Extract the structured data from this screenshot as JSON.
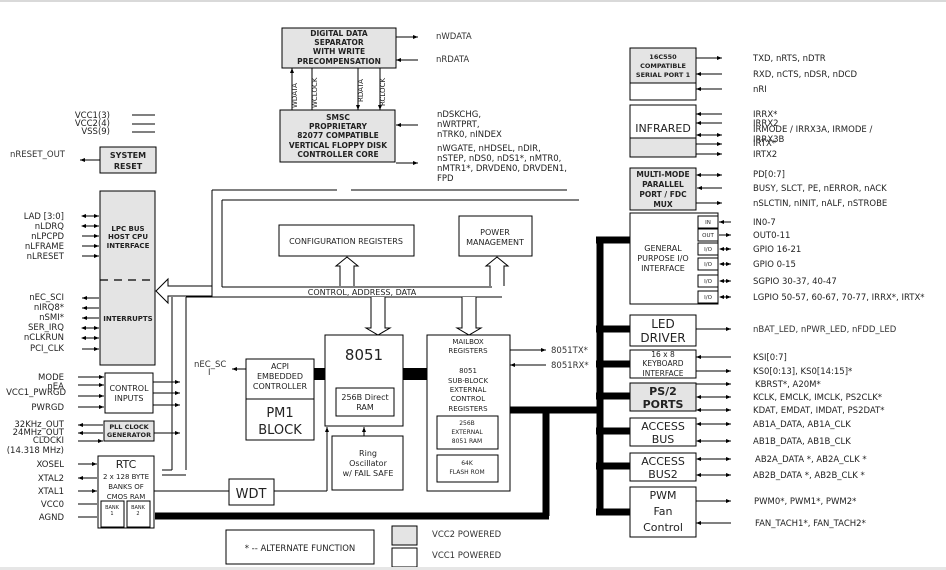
{
  "blocks": {
    "dds": [
      "DIGITAL DATA",
      "SEPARATOR",
      "WITH WRITE",
      "PRECOMPENSATION"
    ],
    "fdc": [
      "SMSC",
      "PROPRIETARY",
      "82077 COMPATIBLE",
      "VERTICAL FLOPPY DISK",
      "CONTROLLER CORE"
    ],
    "dds_fdc_signals": [
      "WDATA",
      "WCLOCK",
      "RDATA",
      "RCLOCK"
    ],
    "system_reset": [
      "SYSTEM",
      "RESET"
    ],
    "lpc": [
      "LPC BUS",
      "HOST CPU",
      "INTERFACE"
    ],
    "interrupts": "INTERRUPTS",
    "config_registers": "CONFIGURATION REGISTERS",
    "power_mgmt": [
      "POWER",
      "MANAGEMENT"
    ],
    "bus_label": "CONTROL, ADDRESS, DATA",
    "control_inputs": [
      "CONTROL",
      "INPUTS"
    ],
    "pll": [
      "PLL CLOCK",
      "GENERATOR"
    ],
    "rtc": [
      "RTC",
      "2 x 128 BYTE",
      "BANKS OF",
      "CMOS RAM"
    ],
    "bank1": [
      "BANK",
      "1"
    ],
    "bank2": [
      "BANK",
      "2"
    ],
    "acpi": [
      "ACPI",
      "EMBEDDED",
      "CONTROLLER"
    ],
    "pm1": [
      "PM1",
      "BLOCK"
    ],
    "cpu8051": "8051",
    "direct_ram": [
      "256B Direct",
      "RAM"
    ],
    "ring_osc": [
      "Ring",
      "Oscillator",
      "w/ FAIL SAFE"
    ],
    "wdt": "WDT",
    "mailbox": [
      "MAILBOX",
      "REGISTERS"
    ],
    "subblock": [
      "8051",
      "SUB-BLOCK",
      "EXTERNAL",
      "CONTROL",
      "REGISTERS"
    ],
    "ext_ram": [
      "256B",
      "EXTERNAL",
      "8051 RAM"
    ],
    "flash": [
      "64K",
      "FLASH ROM"
    ],
    "serial": [
      "16C550",
      "COMPATIBLE",
      "SERIAL PORT 1"
    ],
    "infrared": "INFRARED",
    "parallel": [
      "MULTI-MODE",
      "PARALLEL",
      "PORT / FDC",
      "MUX"
    ],
    "gpio": [
      "GENERAL",
      "PURPOSE I/O",
      "INTERFACE"
    ],
    "gpio_ports": [
      "IN",
      "OUT",
      "I/O",
      "I/O",
      "I/O",
      "I/O"
    ],
    "led": [
      "LED",
      "DRIVER"
    ],
    "keyboard": [
      "16 x 8",
      "KEYBOARD",
      "INTERFACE"
    ],
    "ps2": [
      "PS/2",
      "PORTS"
    ],
    "access_bus": [
      "ACCESS",
      "BUS"
    ],
    "access_bus2": [
      "ACCESS",
      "BUS2"
    ],
    "pwm": [
      "PWM",
      "Fan",
      "Control"
    ]
  },
  "signals": {
    "dds_right": [
      "nWDATA",
      "nRDATA"
    ],
    "fdc_right": [
      "nDSKCHG,",
      "nWRTPRT,",
      "nTRK0, nINDEX",
      "nWGATE, nHDSEL, nDIR,",
      "nSTEP, nDS0, nDS1*, nMTR0,",
      "nMTR1*, DRVDEN0, DRVDEN1,",
      "FPD"
    ],
    "power_pins": [
      "VCC1(3)",
      "VCC2(4)",
      "VSS(9)"
    ],
    "reset_out": "nRESET_OUT",
    "lpc_pins": [
      "LAD [3:0]",
      "nLDRQ",
      "nLPCPD",
      "nLFRAME",
      "nLRESET"
    ],
    "irq_pins": [
      "nEC_SCI",
      "nIRQ8*",
      "nSMI*",
      "SER_IRQ",
      "nCLKRUN",
      "PCI_CLK"
    ],
    "control_pins": [
      "MODE",
      "nEA",
      "VCC1_PWRGD",
      "PWRGD"
    ],
    "clock_pins": [
      "32KHz_OUT",
      "24MHz_OUT",
      "CLOCKI",
      "(14.318 MHz)"
    ],
    "rtc_pins": [
      "XOSEL",
      "XTAL2",
      "XTAL1",
      "VCC0",
      "AGND"
    ],
    "acpi_sci": [
      "nEC_SC",
      "I"
    ],
    "mailbox_pins": [
      "8051TX*",
      "8051RX*"
    ],
    "serial_pins": [
      "TXD, nRTS, nDTR",
      "RXD, nCTS, nDSR, nDCD",
      "nRI"
    ],
    "ir_pins": [
      "IRRX*",
      "IRRX2",
      "IRMODE / IRRX3A, IRMODE /",
      "IRRX3B",
      "IRTX*",
      "IRTX2"
    ],
    "parallel_pins": [
      "PD[0:7]",
      "BUSY, SLCT, PE, nERROR, nACK",
      "nSLCTIN, nINIT, nALF,  nSTROBE"
    ],
    "gpio_pins": [
      "IN0-7",
      "OUT0-11",
      "GPIO 16-21",
      "GPIO 0-15",
      "SGPIO 30-37, 40-47",
      "LGPIO 50-57, 60-67, 70-77, IRRX*, IRTX*"
    ],
    "led_pins": "nBAT_LED, nPWR_LED, nFDD_LED",
    "kbd_pins": [
      "KSI[0:7]",
      "KS0[0:13], KS0[14:15]*"
    ],
    "ps2_pins": [
      "KBRST*, A20M*",
      "KCLK, EMCLK, IMCLK, PS2CLK*",
      "KDAT, EMDAT, IMDAT, PS2DAT*"
    ],
    "ab_pins": [
      "AB1A_DATA, AB1A_CLK",
      "AB1B_DATA, AB1B_CLK"
    ],
    "ab2_pins": [
      "AB2A_DATA *, AB2A_CLK *",
      "AB2B_DATA *, AB2B_CLK *"
    ],
    "pwm_pins": [
      "PWM0*, PWM1*, PWM2*",
      "FAN_TACH1*, FAN_TACH2*"
    ]
  },
  "legend": {
    "alternate": "* -- ALTERNATE FUNCTION",
    "vcc2": "VCC2 POWERED",
    "vcc1": "VCC1 POWERED",
    "vcc2_color": "#e4e4e4",
    "vcc1_color": "#ffffff"
  }
}
